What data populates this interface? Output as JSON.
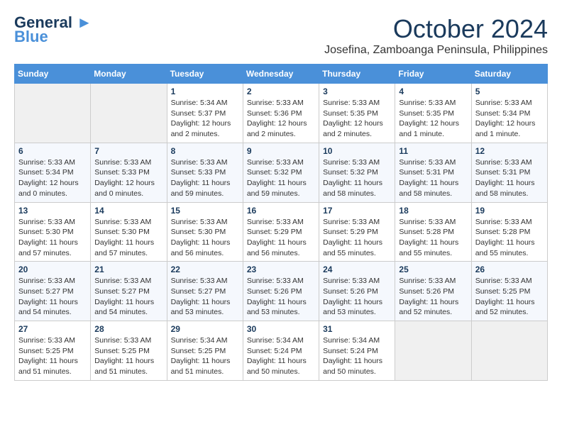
{
  "header": {
    "logo_line1": "General",
    "logo_line2": "Blue",
    "month_title": "October 2024",
    "location": "Josefina, Zamboanga Peninsula, Philippines"
  },
  "weekdays": [
    "Sunday",
    "Monday",
    "Tuesday",
    "Wednesday",
    "Thursday",
    "Friday",
    "Saturday"
  ],
  "weeks": [
    [
      {
        "day": "",
        "info": ""
      },
      {
        "day": "",
        "info": ""
      },
      {
        "day": "1",
        "info": "Sunrise: 5:34 AM\nSunset: 5:37 PM\nDaylight: 12 hours\nand 2 minutes."
      },
      {
        "day": "2",
        "info": "Sunrise: 5:33 AM\nSunset: 5:36 PM\nDaylight: 12 hours\nand 2 minutes."
      },
      {
        "day": "3",
        "info": "Sunrise: 5:33 AM\nSunset: 5:35 PM\nDaylight: 12 hours\nand 2 minutes."
      },
      {
        "day": "4",
        "info": "Sunrise: 5:33 AM\nSunset: 5:35 PM\nDaylight: 12 hours\nand 1 minute."
      },
      {
        "day": "5",
        "info": "Sunrise: 5:33 AM\nSunset: 5:34 PM\nDaylight: 12 hours\nand 1 minute."
      }
    ],
    [
      {
        "day": "6",
        "info": "Sunrise: 5:33 AM\nSunset: 5:34 PM\nDaylight: 12 hours\nand 0 minutes."
      },
      {
        "day": "7",
        "info": "Sunrise: 5:33 AM\nSunset: 5:33 PM\nDaylight: 12 hours\nand 0 minutes."
      },
      {
        "day": "8",
        "info": "Sunrise: 5:33 AM\nSunset: 5:33 PM\nDaylight: 11 hours\nand 59 minutes."
      },
      {
        "day": "9",
        "info": "Sunrise: 5:33 AM\nSunset: 5:32 PM\nDaylight: 11 hours\nand 59 minutes."
      },
      {
        "day": "10",
        "info": "Sunrise: 5:33 AM\nSunset: 5:32 PM\nDaylight: 11 hours\nand 58 minutes."
      },
      {
        "day": "11",
        "info": "Sunrise: 5:33 AM\nSunset: 5:31 PM\nDaylight: 11 hours\nand 58 minutes."
      },
      {
        "day": "12",
        "info": "Sunrise: 5:33 AM\nSunset: 5:31 PM\nDaylight: 11 hours\nand 58 minutes."
      }
    ],
    [
      {
        "day": "13",
        "info": "Sunrise: 5:33 AM\nSunset: 5:30 PM\nDaylight: 11 hours\nand 57 minutes."
      },
      {
        "day": "14",
        "info": "Sunrise: 5:33 AM\nSunset: 5:30 PM\nDaylight: 11 hours\nand 57 minutes."
      },
      {
        "day": "15",
        "info": "Sunrise: 5:33 AM\nSunset: 5:30 PM\nDaylight: 11 hours\nand 56 minutes."
      },
      {
        "day": "16",
        "info": "Sunrise: 5:33 AM\nSunset: 5:29 PM\nDaylight: 11 hours\nand 56 minutes."
      },
      {
        "day": "17",
        "info": "Sunrise: 5:33 AM\nSunset: 5:29 PM\nDaylight: 11 hours\nand 55 minutes."
      },
      {
        "day": "18",
        "info": "Sunrise: 5:33 AM\nSunset: 5:28 PM\nDaylight: 11 hours\nand 55 minutes."
      },
      {
        "day": "19",
        "info": "Sunrise: 5:33 AM\nSunset: 5:28 PM\nDaylight: 11 hours\nand 55 minutes."
      }
    ],
    [
      {
        "day": "20",
        "info": "Sunrise: 5:33 AM\nSunset: 5:27 PM\nDaylight: 11 hours\nand 54 minutes."
      },
      {
        "day": "21",
        "info": "Sunrise: 5:33 AM\nSunset: 5:27 PM\nDaylight: 11 hours\nand 54 minutes."
      },
      {
        "day": "22",
        "info": "Sunrise: 5:33 AM\nSunset: 5:27 PM\nDaylight: 11 hours\nand 53 minutes."
      },
      {
        "day": "23",
        "info": "Sunrise: 5:33 AM\nSunset: 5:26 PM\nDaylight: 11 hours\nand 53 minutes."
      },
      {
        "day": "24",
        "info": "Sunrise: 5:33 AM\nSunset: 5:26 PM\nDaylight: 11 hours\nand 53 minutes."
      },
      {
        "day": "25",
        "info": "Sunrise: 5:33 AM\nSunset: 5:26 PM\nDaylight: 11 hours\nand 52 minutes."
      },
      {
        "day": "26",
        "info": "Sunrise: 5:33 AM\nSunset: 5:25 PM\nDaylight: 11 hours\nand 52 minutes."
      }
    ],
    [
      {
        "day": "27",
        "info": "Sunrise: 5:33 AM\nSunset: 5:25 PM\nDaylight: 11 hours\nand 51 minutes."
      },
      {
        "day": "28",
        "info": "Sunrise: 5:33 AM\nSunset: 5:25 PM\nDaylight: 11 hours\nand 51 minutes."
      },
      {
        "day": "29",
        "info": "Sunrise: 5:34 AM\nSunset: 5:25 PM\nDaylight: 11 hours\nand 51 minutes."
      },
      {
        "day": "30",
        "info": "Sunrise: 5:34 AM\nSunset: 5:24 PM\nDaylight: 11 hours\nand 50 minutes."
      },
      {
        "day": "31",
        "info": "Sunrise: 5:34 AM\nSunset: 5:24 PM\nDaylight: 11 hours\nand 50 minutes."
      },
      {
        "day": "",
        "info": ""
      },
      {
        "day": "",
        "info": ""
      }
    ]
  ]
}
